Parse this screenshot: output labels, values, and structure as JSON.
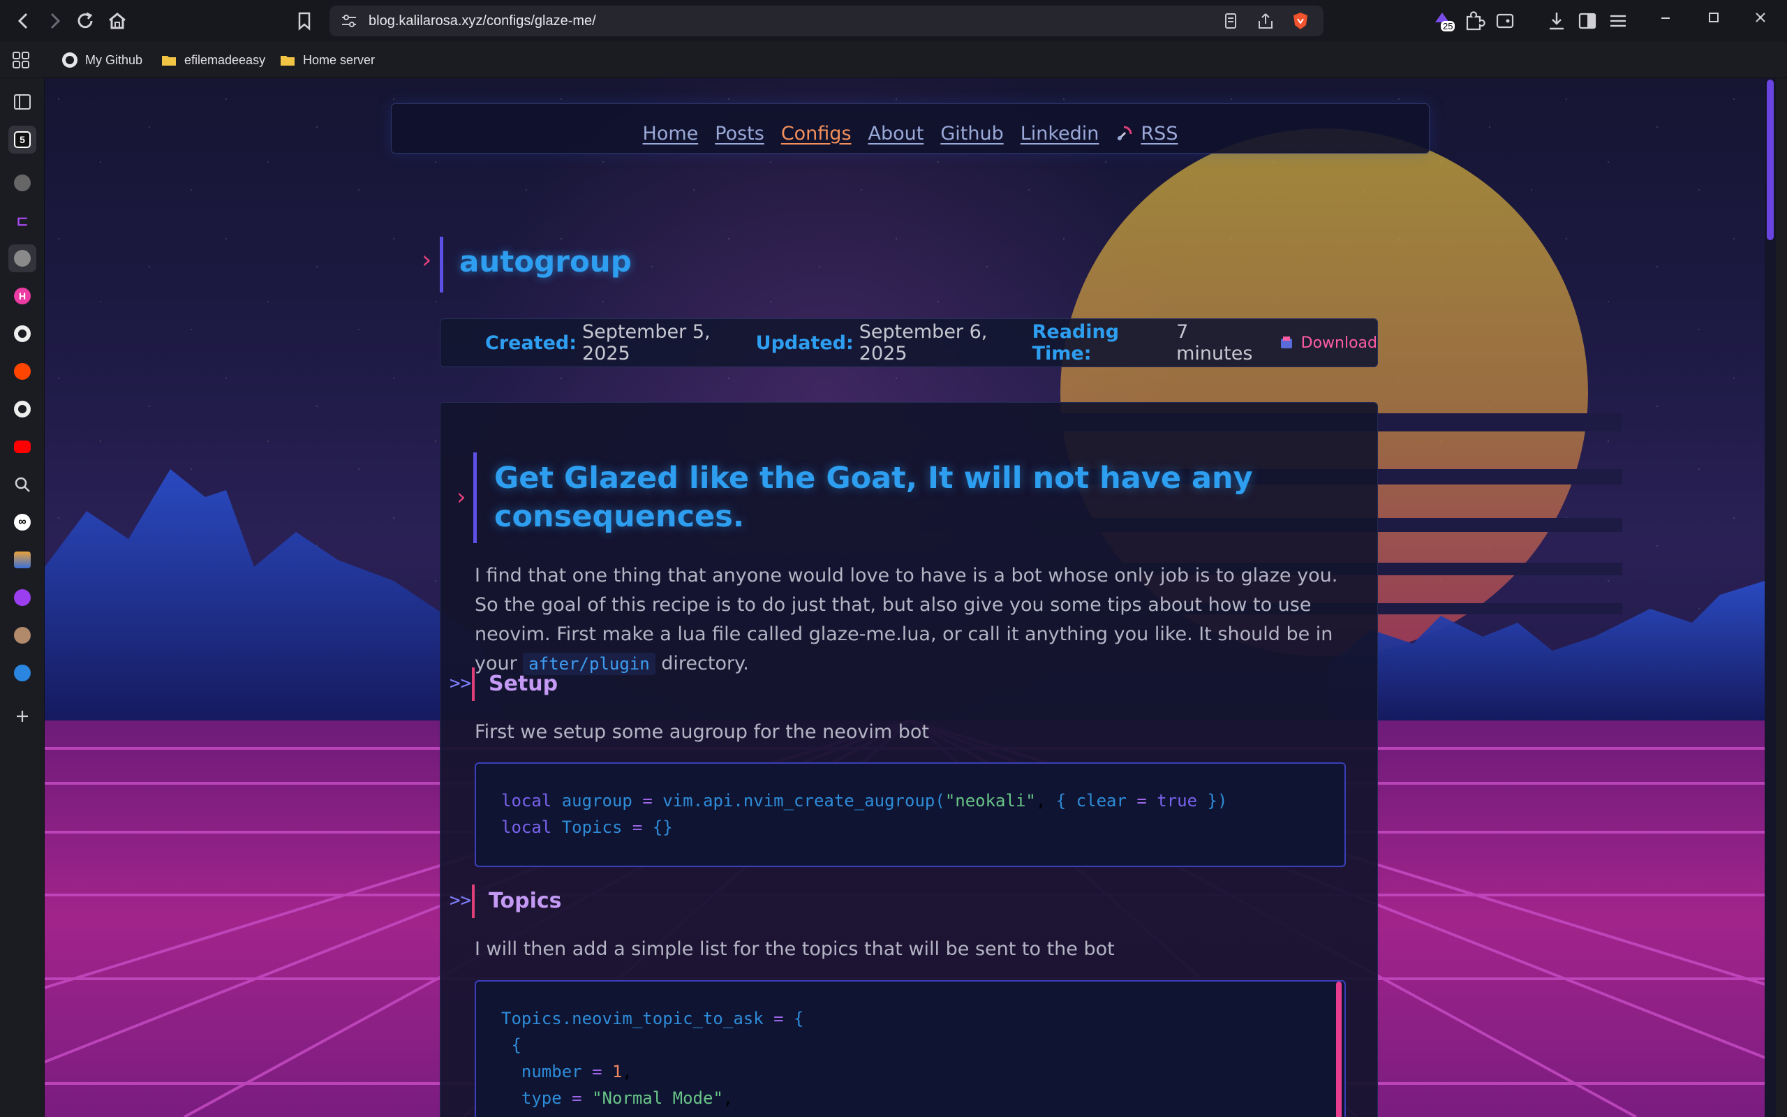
{
  "browser": {
    "url": "blog.kalilarosa.xyz/configs/glaze-me/",
    "extension_badge": "25",
    "bookmarks": [
      {
        "label": "My Github",
        "icon": "github-icon"
      },
      {
        "label": "efilemadeeasy",
        "icon": "folder-icon"
      },
      {
        "label": "Home server",
        "icon": "folder-icon"
      }
    ],
    "sidebar_sites": [
      "library-icon",
      "5-icon",
      "avatar-icon",
      "chat-icon",
      "globe-icon",
      "h-icon",
      "github-icon",
      "reddit-icon",
      "github-icon",
      "youtube-icon",
      "search-icon",
      "infinity-icon",
      "image-icon",
      "pill-icon",
      "avatar-icon",
      "spiral-icon",
      "plus-icon"
    ]
  },
  "nav": {
    "links": [
      "Home",
      "Posts",
      "Configs",
      "About",
      "Github",
      "Linkedin",
      "RSS"
    ],
    "current": "Configs"
  },
  "post": {
    "title": "autogroup",
    "meta": {
      "created_label": "Created:",
      "created": "September 5, 2025",
      "updated_label": "Updated:",
      "updated": "September 6, 2025",
      "reading_label": "Reading Time:",
      "reading": "7 minutes",
      "download": "Download"
    },
    "heading": "Get Glazed like the Goat, It will not have any consequences.",
    "intro_before": "I find that one thing that anyone would love to have is a bot whose only job is to glaze you. So the goal of this recipe is to do just that, but also give you some tips about how to use neovim. First make a lua file called glaze-me.lua, or call it anything you like. It should be in your ",
    "intro_code": "after/plugin",
    "intro_after": " directory.",
    "sections": [
      {
        "chevron": ">>",
        "title": "Setup",
        "text": "First we setup some augroup for the neovim bot"
      },
      {
        "chevron": ">>",
        "title": "Topics",
        "text": "I will then add a simple list for the topics that will be sent to the bot"
      }
    ],
    "code1": [
      "local augroup = vim.api.nvim_create_augroup(\"neokali\", { clear = true })",
      "local Topics = {}"
    ],
    "code2": [
      "Topics.neovim_topic_to_ask = {",
      " {",
      "  number = 1,",
      "  type = \"Normal Mode\","
    ]
  },
  "colors": {
    "accent_blue": "#2e9ef0",
    "accent_pink": "#e0407a",
    "accent_orange": "#f4905c",
    "accent_purple": "#5d50e6"
  }
}
